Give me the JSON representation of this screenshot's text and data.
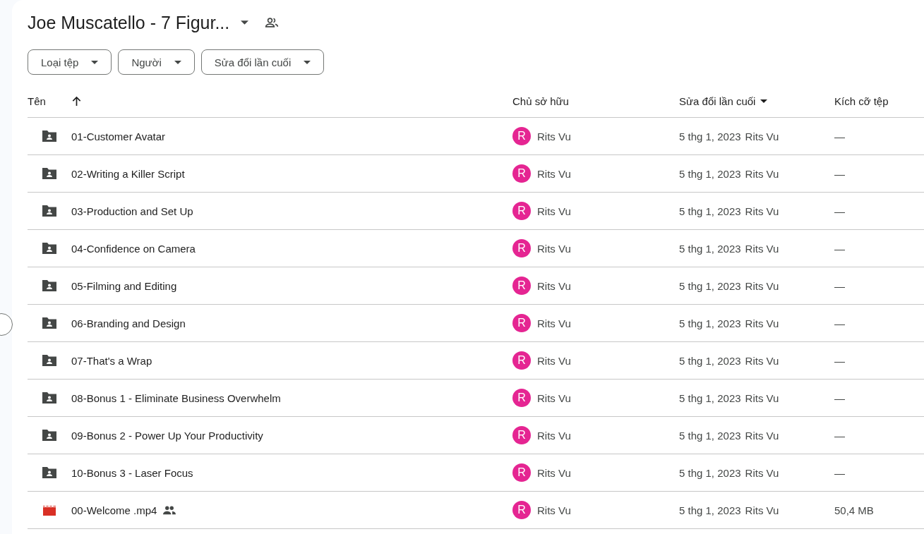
{
  "title": "Joe Muscatello - 7 Figur...",
  "filters": [
    "Loại tệp",
    "Người",
    "Sửa đổi lần cuối"
  ],
  "columns": [
    {
      "label": "Tên",
      "kind": "sort_arrow"
    },
    {
      "label": "Chủ sở hữu",
      "kind": "plain"
    },
    {
      "label": "Sửa đổi lần cuối",
      "kind": "menu_caret"
    },
    {
      "label": "Kích cỡ tệp",
      "kind": "plain"
    }
  ],
  "rows": [
    {
      "kind": "folder",
      "name": "01-Customer Avatar",
      "shared": false,
      "owner_initial": "R",
      "owner": "Rits Vu",
      "modified": "5 thg 1, 2023",
      "modified_by": "Rits Vu",
      "size": "—"
    },
    {
      "kind": "folder",
      "name": "02-Writing a Killer Script",
      "shared": false,
      "owner_initial": "R",
      "owner": "Rits Vu",
      "modified": "5 thg 1, 2023",
      "modified_by": "Rits Vu",
      "size": "—"
    },
    {
      "kind": "folder",
      "name": "03-Production and Set Up",
      "shared": false,
      "owner_initial": "R",
      "owner": "Rits Vu",
      "modified": "5 thg 1, 2023",
      "modified_by": "Rits Vu",
      "size": "—"
    },
    {
      "kind": "folder",
      "name": "04-Confidence on Camera",
      "shared": false,
      "owner_initial": "R",
      "owner": "Rits Vu",
      "modified": "5 thg 1, 2023",
      "modified_by": "Rits Vu",
      "size": "—"
    },
    {
      "kind": "folder",
      "name": "05-Filming and Editing",
      "shared": false,
      "owner_initial": "R",
      "owner": "Rits Vu",
      "modified": "5 thg 1, 2023",
      "modified_by": "Rits Vu",
      "size": "—"
    },
    {
      "kind": "folder",
      "name": "06-Branding and Design",
      "shared": false,
      "owner_initial": "R",
      "owner": "Rits Vu",
      "modified": "5 thg 1, 2023",
      "modified_by": "Rits Vu",
      "size": "—"
    },
    {
      "kind": "folder",
      "name": "07-That's a Wrap",
      "shared": false,
      "owner_initial": "R",
      "owner": "Rits Vu",
      "modified": "5 thg 1, 2023",
      "modified_by": "Rits Vu",
      "size": "—"
    },
    {
      "kind": "folder",
      "name": "08-Bonus 1 - Eliminate Business Overwhelm",
      "shared": false,
      "owner_initial": "R",
      "owner": "Rits Vu",
      "modified": "5 thg 1, 2023",
      "modified_by": "Rits Vu",
      "size": "—"
    },
    {
      "kind": "folder",
      "name": "09-Bonus 2 - Power Up Your Productivity",
      "shared": false,
      "owner_initial": "R",
      "owner": "Rits Vu",
      "modified": "5 thg 1, 2023",
      "modified_by": "Rits Vu",
      "size": "—"
    },
    {
      "kind": "folder",
      "name": "10-Bonus 3 - Laser Focus",
      "shared": false,
      "owner_initial": "R",
      "owner": "Rits Vu",
      "modified": "5 thg 1, 2023",
      "modified_by": "Rits Vu",
      "size": "—"
    },
    {
      "kind": "video",
      "name": "00-Welcome .mp4",
      "shared": true,
      "owner_initial": "R",
      "owner": "Rits Vu",
      "modified": "5 thg 1, 2023",
      "modified_by": "Rits Vu",
      "size": "50,4 MB"
    }
  ]
}
